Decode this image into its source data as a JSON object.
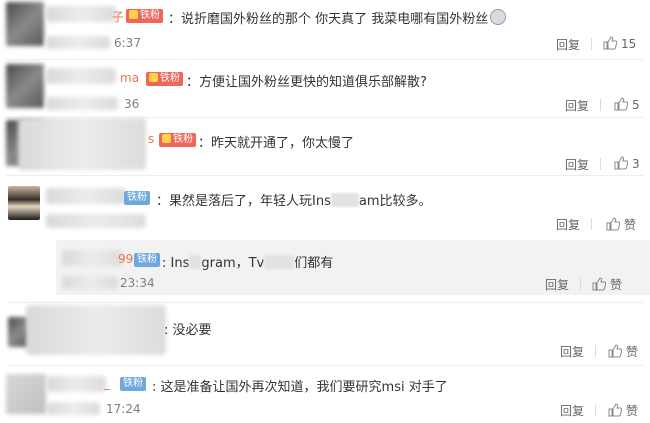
{
  "labels": {
    "reply": "回复",
    "like": "赞"
  },
  "comments": [
    {
      "badge": "铁粉",
      "text": "说折磨国外粉丝的那个  你天真了  我菜电哪有国外粉丝",
      "time": "6:37",
      "likes": "15",
      "name_visible": "子"
    },
    {
      "badge": "铁粉",
      "text": "方便让国外粉丝更快的知道俱乐部解散?",
      "time": "36",
      "likes": "5",
      "name_visible": "ma"
    },
    {
      "badge": "铁粉",
      "text": "昨天就开通了，你太慢了",
      "time": "",
      "likes": "3",
      "name_visible": "s"
    },
    {
      "badge": "铁粉",
      "text_a": "果然是落后了，年轻人玩Ins",
      "text_b": "am比较多。",
      "time": "",
      "likes": "",
      "name_visible": ""
    },
    {
      "badge": "铁粉",
      "text_a": "Ins",
      "text_b": "gram，Tv",
      "text_c": "们都有",
      "time": "23:34",
      "likes": "",
      "name_visible": "99",
      "prefix": ":"
    },
    {
      "badge": "",
      "text": "没必要",
      "time": "",
      "likes": "",
      "name_visible": "",
      "prefix": ":"
    },
    {
      "badge": "铁粉",
      "text": "这是准备让国外再次知道，我们要研究msi 对手了",
      "time": "17:24",
      "likes": "",
      "name_visible": "_",
      "prefix": ":"
    }
  ],
  "colors": {
    "name": "#eb7350",
    "badge_iron": "#6fa8dc",
    "badge_red": "#f0665a"
  },
  "icons": [
    "thumbs-up-icon",
    "crown-badge-icon",
    "emoji-icon"
  ]
}
